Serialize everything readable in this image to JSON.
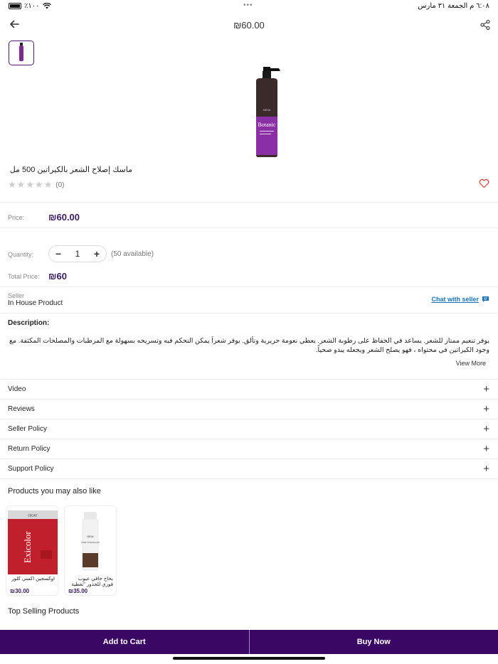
{
  "status_bar": {
    "battery": "٪١٠٠",
    "datetime": "٦:٠٨ م   الجمعة ٣١ مارس",
    "dots": "•••"
  },
  "header": {
    "title": "₪60.00"
  },
  "product": {
    "name": "ماسك إصلاح الشعر  بالكيراتين 500 مل",
    "rating_stars": 0,
    "rating_count": "(0)",
    "price_label": "Price:",
    "price": "₪60.00",
    "quantity_label": "Quantity:",
    "quantity": "1",
    "available": "(50 available)",
    "total_label": "Total Price:",
    "total": "₪60",
    "bottle_brand": "Botanic",
    "bottle_maker": "NEVA"
  },
  "seller": {
    "label": "Seller",
    "name": "In House Product",
    "chat_label": "Chat with seller"
  },
  "description": {
    "label": "Description:",
    "text": "يوفر تنعيم ممتاز للشعر. يساعد في الحفاظ على رطوبة الشعر. يعطي نعومة حريرية وتألق. يوفر شعراً يمكن التحكم فيه وتسريحه بسهولة مع المرطبات والمصلحات المكثفة. مع وجود الكيراتين في محتواه ، فهو يصلح الشعر ويجعله يبدو صحياً.",
    "view_more": "View More"
  },
  "accordions": [
    {
      "label": "Video"
    },
    {
      "label": "Reviews"
    },
    {
      "label": "Seller Policy"
    },
    {
      "label": "Return Policy"
    },
    {
      "label": "Support Policy"
    }
  ],
  "related": {
    "title": "Products you may also like",
    "items": [
      {
        "name": "اوكسجين اكسي كلور",
        "price": "₪30.00",
        "brand": "Exicolor"
      },
      {
        "name": "بخاخ خافي عيوب فوري للجذور \"تغطية الشيب ...",
        "price": "₪35.00",
        "brand": "ROOT TOUCH-UP"
      }
    ]
  },
  "top_selling": {
    "title": "Top Selling Products"
  },
  "actions": {
    "add_to_cart": "Add to Cart",
    "buy_now": "Buy Now"
  },
  "colors": {
    "brand_purple": "#3b0764",
    "price_purple": "#3a1a5f",
    "link_blue": "#1a73b8",
    "heart_red": "#e53935"
  }
}
